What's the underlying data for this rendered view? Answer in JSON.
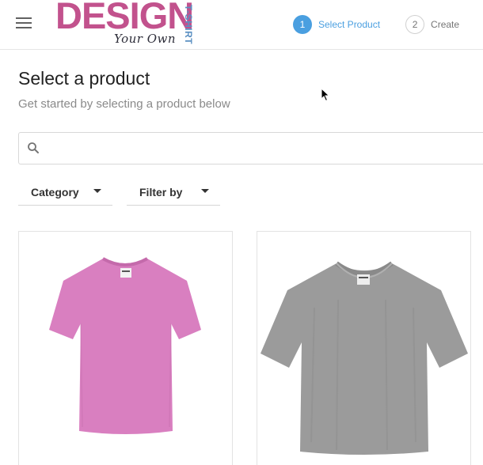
{
  "header": {
    "logo": {
      "main": "DESIGN",
      "sub": "Your Own",
      "side": "T-SHIRT"
    },
    "steps": [
      {
        "number": "1",
        "label": "Select Product",
        "state": "active"
      },
      {
        "number": "2",
        "label": "Create",
        "state": "inactive"
      }
    ]
  },
  "main": {
    "title": "Select a product",
    "subtitle": "Get started by selecting a product below",
    "search": {
      "placeholder": "",
      "value": ""
    },
    "filters": [
      {
        "label": "Category"
      },
      {
        "label": "Filter by"
      }
    ],
    "products": [
      {
        "icon": "tshirt-pink-icon",
        "color": "#d97fc0"
      },
      {
        "icon": "tshirt-gray-icon",
        "color": "#9b9b9b"
      }
    ]
  },
  "colors": {
    "brand_pink": "#c2528d",
    "brand_blue": "#5a8fc2",
    "accent": "#4a9fe0"
  }
}
